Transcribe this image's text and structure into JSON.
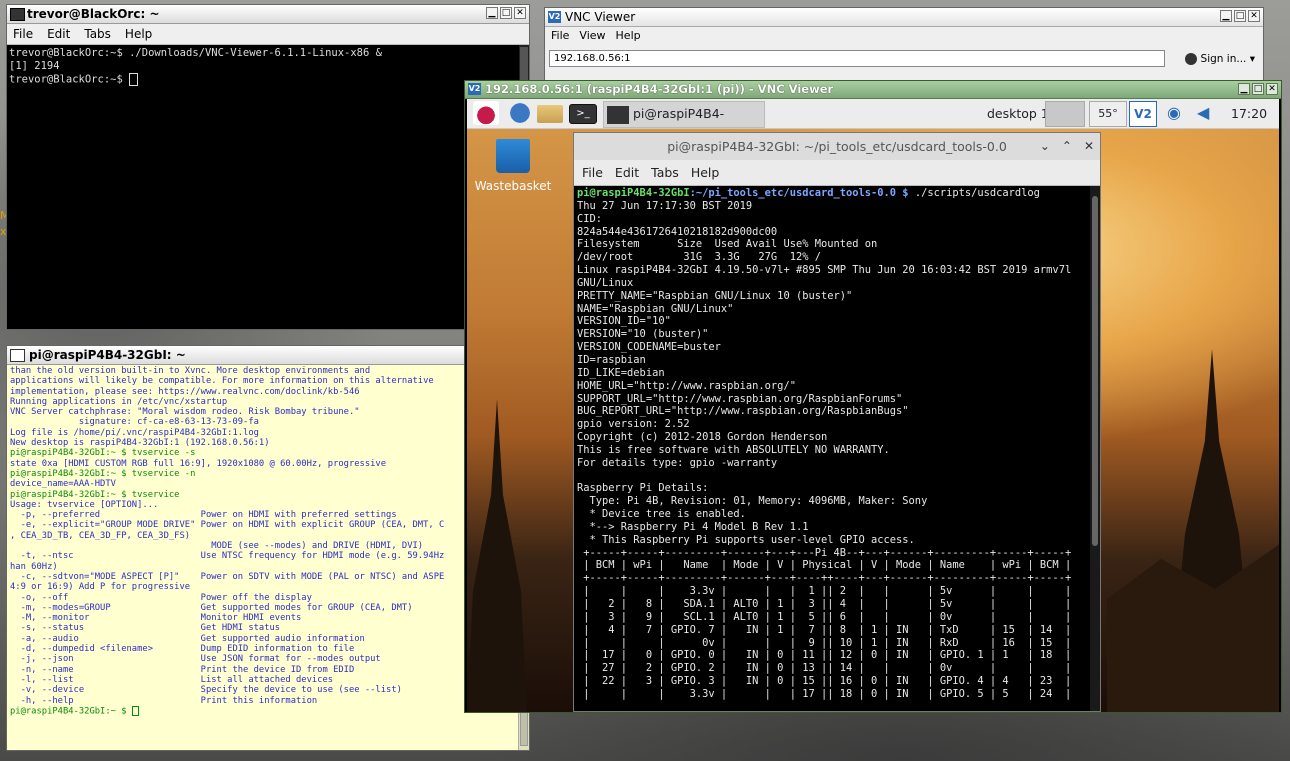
{
  "terminal1": {
    "title": "trevor@BlackOrc: ~",
    "menu": [
      "File",
      "Edit",
      "Tabs",
      "Help"
    ],
    "lines": [
      "trevor@BlackOrc:~$ ./Downloads/VNC-Viewer-6.1.1-Linux-x86 &",
      "[1] 2194",
      "trevor@BlackOrc:~$ "
    ]
  },
  "terminal2": {
    "title": "pi@raspiP4B4-32GbI: ~",
    "lines": [
      {
        "t": "than the old version built-in to Xvnc. More desktop environments and",
        "c": ""
      },
      {
        "t": "applications will likely be compatible. For more information on this alternative",
        "c": ""
      },
      {
        "t": "implementation, please see: https://www.realvnc.com/doclink/kb-546",
        "c": ""
      },
      {
        "t": "",
        "c": ""
      },
      {
        "t": "Running applications in /etc/vnc/xstartup",
        "c": ""
      },
      {
        "t": "",
        "c": ""
      },
      {
        "t": "VNC Server catchphrase: \"Moral wisdom rodeo. Risk Bombay tribune.\"",
        "c": ""
      },
      {
        "t": "             signature: cf-ca-e8-63-13-73-09-fa",
        "c": ""
      },
      {
        "t": "",
        "c": ""
      },
      {
        "t": "Log file is /home/pi/.vnc/raspiP4B4-32GbI:1.log",
        "c": ""
      },
      {
        "t": "New desktop is raspiP4B4-32GbI:1 (192.168.0.56:1)",
        "c": ""
      },
      {
        "t": "pi@raspiP4B4-32GbI:~ $ tvservice -s",
        "c": "g"
      },
      {
        "t": "state 0xa [HDMI CUSTOM RGB full 16:9], 1920x1080 @ 60.00Hz, progressive",
        "c": ""
      },
      {
        "t": "pi@raspiP4B4-32GbI:~ $ tvservice -n",
        "c": "g"
      },
      {
        "t": "device_name=AAA-HDTV",
        "c": ""
      },
      {
        "t": "pi@raspiP4B4-32GbI:~ $ tvservice",
        "c": "g"
      },
      {
        "t": "Usage: tvservice [OPTION]...",
        "c": ""
      },
      {
        "t": "  -p, --preferred                   Power on HDMI with preferred settings",
        "c": ""
      },
      {
        "t": "  -e, --explicit=\"GROUP MODE DRIVE\" Power on HDMI with explicit GROUP (CEA, DMT, C",
        "c": ""
      },
      {
        "t": ", CEA_3D_TB, CEA_3D_FP, CEA_3D_FS)",
        "c": ""
      },
      {
        "t": "                                      MODE (see --modes) and DRIVE (HDMI, DVI)",
        "c": ""
      },
      {
        "t": "  -t, --ntsc                        Use NTSC frequency for HDMI mode (e.g. 59.94Hz",
        "c": ""
      },
      {
        "t": "han 60Hz)",
        "c": ""
      },
      {
        "t": "  -c, --sdtvon=\"MODE ASPECT [P]\"    Power on SDTV with MODE (PAL or NTSC) and ASPE",
        "c": ""
      },
      {
        "t": "4:9 or 16:9) Add P for progressive",
        "c": ""
      },
      {
        "t": "  -o, --off                         Power off the display",
        "c": ""
      },
      {
        "t": "  -m, --modes=GROUP                 Get supported modes for GROUP (CEA, DMT)",
        "c": ""
      },
      {
        "t": "  -M, --monitor                     Monitor HDMI events",
        "c": ""
      },
      {
        "t": "  -s, --status                      Get HDMI status",
        "c": ""
      },
      {
        "t": "  -a, --audio                       Get supported audio information",
        "c": ""
      },
      {
        "t": "  -d, --dumpedid <filename>         Dump EDID information to file",
        "c": ""
      },
      {
        "t": "  -j, --json                        Use JSON format for --modes output",
        "c": ""
      },
      {
        "t": "  -n, --name                        Print the device ID from EDID",
        "c": ""
      },
      {
        "t": "  -l, --list                        List all attached devices",
        "c": ""
      },
      {
        "t": "  -v, --device                      Specify the device to use (see --list)",
        "c": ""
      },
      {
        "t": "  -h, --help                        Print this information",
        "c": ""
      },
      {
        "t": "pi@raspiP4B4-32GbI:~ $ ",
        "c": "g"
      }
    ]
  },
  "vnc_viewer": {
    "title": "VNC Viewer",
    "menu": [
      "File",
      "View",
      "Help"
    ],
    "address": "192.168.0.56:1",
    "signin": "Sign in..."
  },
  "vnc_session": {
    "title": "192.168.0.56:1 (raspiP4B4-32GbI:1 (pi)) - VNC Viewer",
    "taskbar_item": "pi@raspiP4B4-32Gb...",
    "desktop_label": "desktop 1",
    "temperature": "55°",
    "clock": "17:20",
    "wastebasket": "Wastebasket"
  },
  "inner_terminal": {
    "title": "pi@raspiP4B4-32GbI: ~/pi_tools_etc/usdcard_tools-0.0",
    "menu": [
      "File",
      "Edit",
      "Tabs",
      "Help"
    ],
    "prompt_user": "pi@raspiP4B4-32GbI",
    "prompt_path": ":~/pi_tools_etc/usdcard_tools-0.0 $",
    "command": " ./scripts/usdcardlog",
    "lines": [
      "Thu 27 Jun 17:17:30 BST 2019",
      "CID:",
      "824a544e4361726410218182d900dc00",
      "Filesystem      Size  Used Avail Use% Mounted on",
      "/dev/root        31G  3.3G   27G  12% /",
      "Linux raspiP4B4-32GbI 4.19.50-v7l+ #895 SMP Thu Jun 20 16:03:42 BST 2019 armv7l",
      "GNU/Linux",
      "PRETTY_NAME=\"Raspbian GNU/Linux 10 (buster)\"",
      "NAME=\"Raspbian GNU/Linux\"",
      "VERSION_ID=\"10\"",
      "VERSION=\"10 (buster)\"",
      "VERSION_CODENAME=buster",
      "ID=raspbian",
      "ID_LIKE=debian",
      "HOME_URL=\"http://www.raspbian.org/\"",
      "SUPPORT_URL=\"http://www.raspbian.org/RaspbianForums\"",
      "BUG_REPORT_URL=\"http://www.raspbian.org/RaspbianBugs\"",
      "gpio version: 2.52",
      "Copyright (c) 2012-2018 Gordon Henderson",
      "This is free software with ABSOLUTELY NO WARRANTY.",
      "For details type: gpio -warranty",
      "",
      "Raspberry Pi Details:",
      "  Type: Pi 4B, Revision: 01, Memory: 4096MB, Maker: Sony",
      "  * Device tree is enabled.",
      "  *--> Raspberry Pi 4 Model B Rev 1.1",
      "  * This Raspberry Pi supports user-level GPIO access.",
      " +-----+-----+---------+------+---+---Pi 4B--+---+------+---------+-----+-----+",
      " | BCM | wPi |   Name  | Mode | V | Physical | V | Mode | Name    | wPi | BCM |",
      " +-----+-----+---------+------+---+----++----+---+------+---------+-----+-----+",
      " |     |     |    3.3v |      |   |  1 || 2  |   |      | 5v      |     |     |",
      " |   2 |   8 |   SDA.1 | ALT0 | 1 |  3 || 4  |   |      | 5v      |     |     |",
      " |   3 |   9 |   SCL.1 | ALT0 | 1 |  5 || 6  |   |      | 0v      |     |     |",
      " |   4 |   7 | GPIO. 7 |   IN | 1 |  7 || 8  | 1 | IN   | TxD     | 15  | 14  |",
      " |     |     |      0v |      |   |  9 || 10 | 1 | IN   | RxD     | 16  | 15  |",
      " |  17 |   0 | GPIO. 0 |   IN | 0 | 11 || 12 | 0 | IN   | GPIO. 1 | 1   | 18  |",
      " |  27 |   2 | GPIO. 2 |   IN | 0 | 13 || 14 |   |      | 0v      |     |     |",
      " |  22 |   3 | GPIO. 3 |   IN | 0 | 15 || 16 | 0 | IN   | GPIO. 4 | 4   | 23  |",
      " |     |     |    3.3v |      |   | 17 || 18 | 0 | IN   | GPIO. 5 | 5   | 24  |"
    ]
  },
  "side_glyphs": [
    "M",
    "x"
  ]
}
